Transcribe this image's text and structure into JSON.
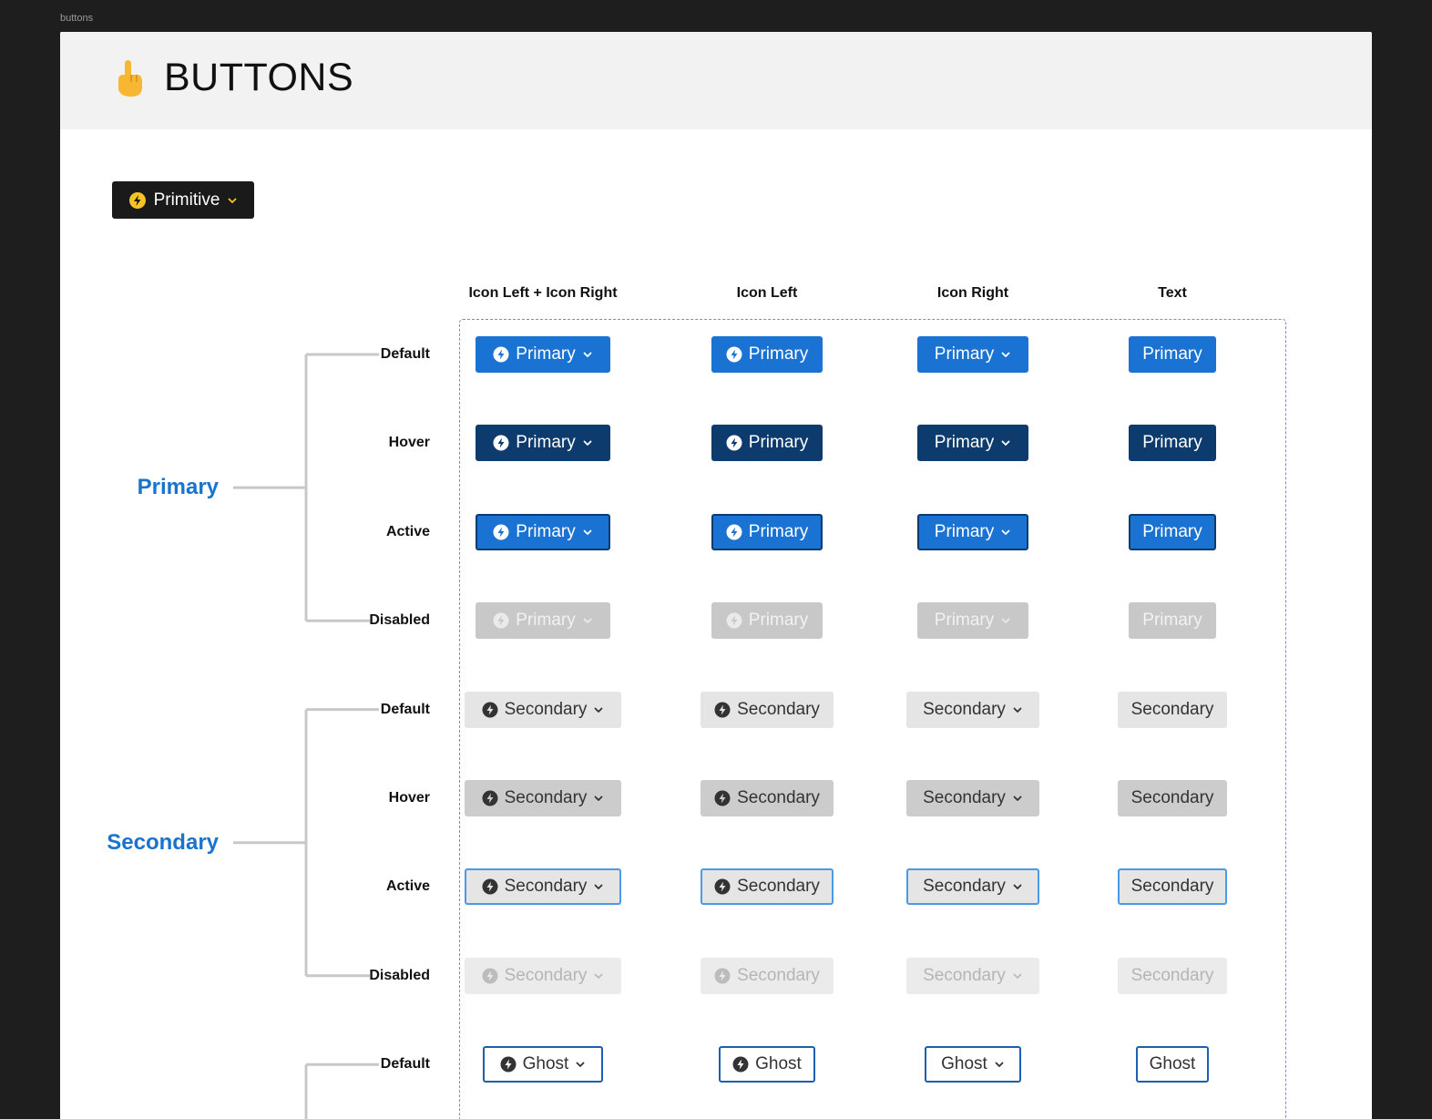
{
  "frame_label": "buttons",
  "title": "BUTTONS",
  "primitive_label": "Primitive",
  "columns": [
    "Icon Left + Icon Right",
    "Icon Left",
    "Icon Right",
    "Text"
  ],
  "groups": [
    {
      "label": "Primary",
      "kind": "primary",
      "states": [
        "Default",
        "Hover",
        "Active",
        "Disabled"
      ]
    },
    {
      "label": "Secondary",
      "kind": "secondary",
      "states": [
        "Default",
        "Hover",
        "Active",
        "Disabled"
      ]
    },
    {
      "label": "",
      "kind": "ghost",
      "states": [
        "Default"
      ]
    }
  ],
  "button_labels": {
    "primary": "Primary",
    "secondary": "Secondary",
    "ghost": "Ghost"
  },
  "colors": {
    "primary": "#1a73d2",
    "primary_hover": "#0d3b6e",
    "secondary": "#e5e5e5",
    "secondary_hover": "#cccccc",
    "active_outline": "#4a9ae8",
    "disabled": "#c8c8c8",
    "group_label": "#1a73cc",
    "dashed_border": "#8b7cf6"
  },
  "icons": {
    "left": "lightning-bolt-icon",
    "right": "chevron-down-icon"
  }
}
